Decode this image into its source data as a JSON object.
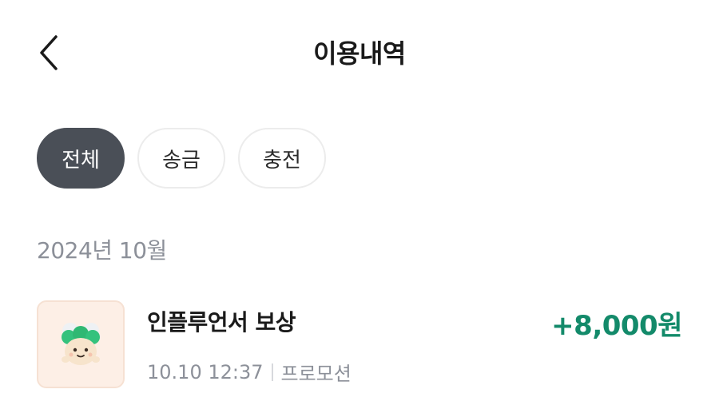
{
  "header": {
    "title": "이용내역",
    "back_icon": "chevron-left-icon"
  },
  "filters": [
    {
      "label": "전체",
      "active": true
    },
    {
      "label": "송금",
      "active": false
    },
    {
      "label": "충전",
      "active": false
    }
  ],
  "sections": [
    {
      "month": "2024년 10월",
      "transactions": [
        {
          "title": "인플루언서 보상",
          "datetime": "10.10 12:37",
          "category": "프로모션",
          "amount": "+8,000원",
          "icon": "character-mascot-icon"
        }
      ]
    }
  ],
  "colors": {
    "active_chip_bg": "#4a4f57",
    "amount_positive": "#138a6a",
    "secondary_text": "#8c9099",
    "thumb_bg": "#fdefe6"
  }
}
